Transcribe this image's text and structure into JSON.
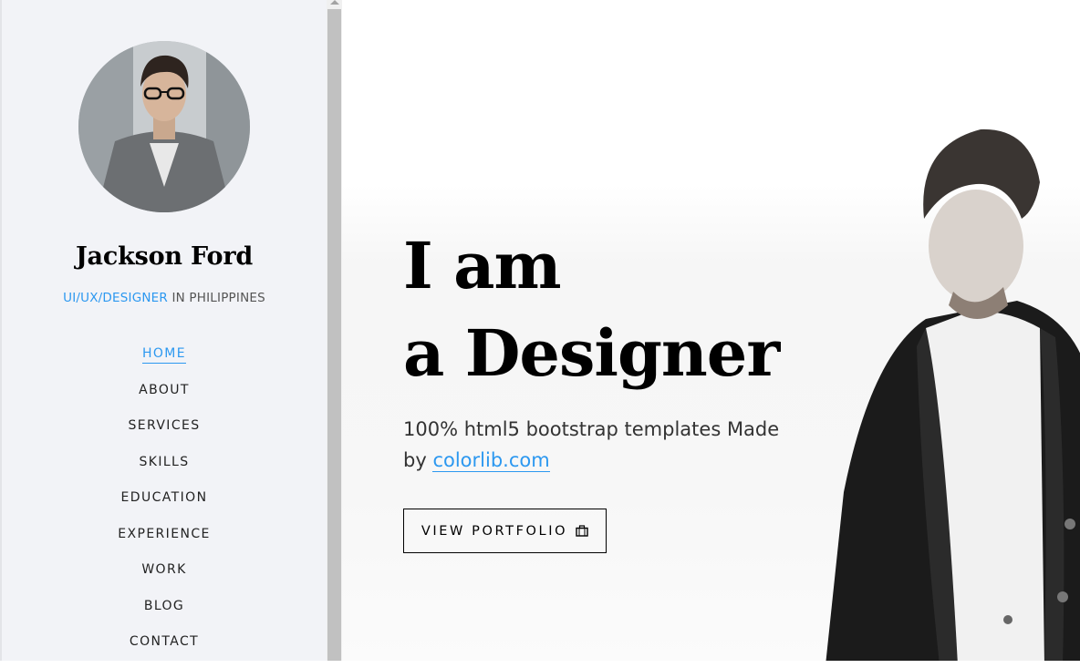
{
  "sidebar": {
    "name": "Jackson Ford",
    "role_accent": "UI/UX/DESIGNER",
    "role_rest": " IN PHILIPPINES",
    "nav": [
      {
        "label": "HOME",
        "active": true
      },
      {
        "label": "ABOUT"
      },
      {
        "label": "SERVICES"
      },
      {
        "label": "SKILLS"
      },
      {
        "label": "EDUCATION"
      },
      {
        "label": "EXPERIENCE"
      },
      {
        "label": "WORK"
      },
      {
        "label": "BLOG"
      },
      {
        "label": "CONTACT"
      }
    ]
  },
  "hero": {
    "line1": "I am",
    "line2": "a Designer",
    "sub_text": "100% html5 bootstrap templates Made by ",
    "sub_link": "colorlib.com",
    "button_label": "VIEW PORTFOLIO",
    "button_icon": "briefcase-icon"
  },
  "colors": {
    "accent": "#2c98f0",
    "sidebar_bg": "#f2f3f7",
    "text": "#000000"
  }
}
